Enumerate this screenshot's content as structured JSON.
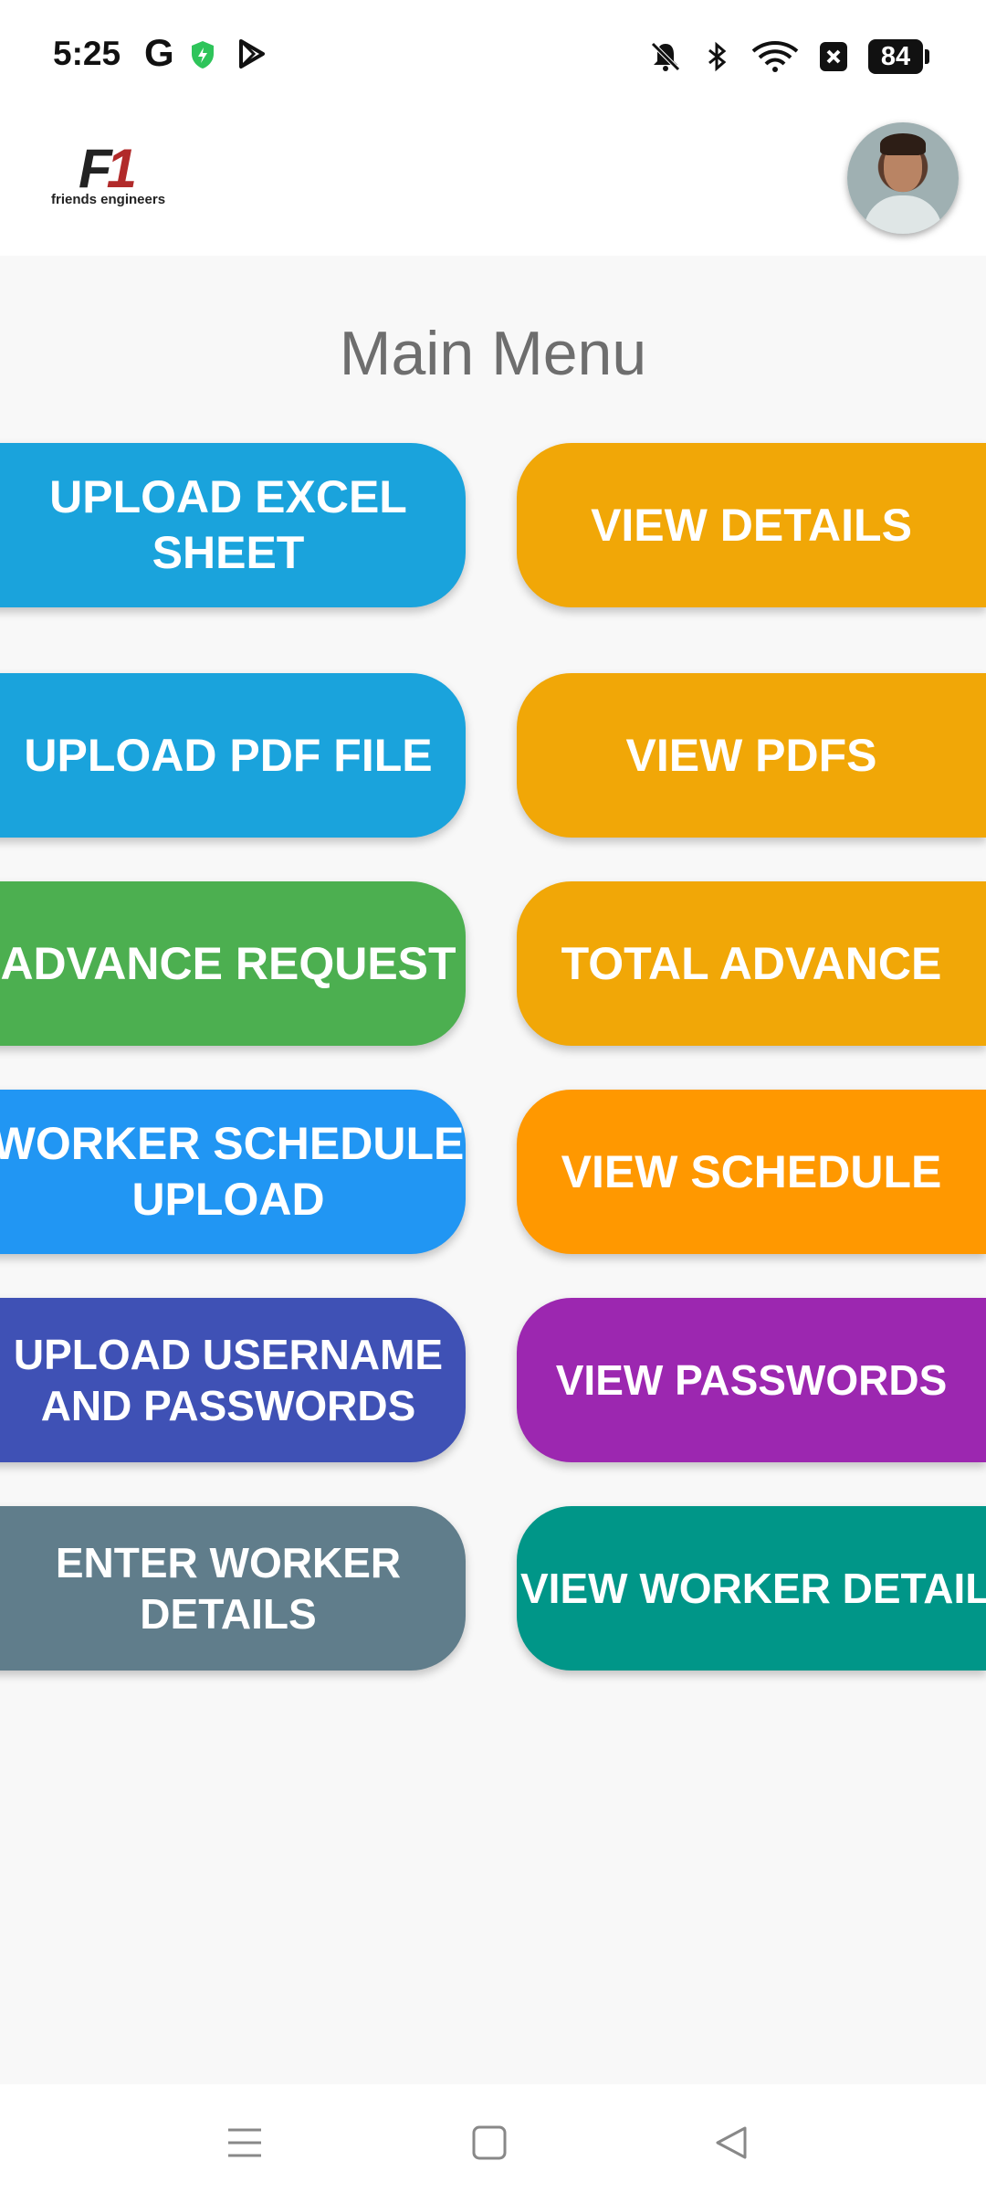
{
  "status_bar": {
    "time": "5:25",
    "g_label": "G",
    "battery": "84",
    "icons": [
      "google-icon",
      "shield-icon",
      "play-icon",
      "bell-off-icon",
      "bluetooth-icon",
      "wifi-icon",
      "close-box-icon",
      "battery-icon"
    ]
  },
  "header": {
    "logo_mark_f": "F",
    "logo_mark_one": "1",
    "logo_text": "friends engineers",
    "avatar": "user-avatar"
  },
  "main": {
    "title": "Main Menu",
    "buttons": [
      {
        "label": "UPLOAD EXCEL\nSHEET",
        "color": "#1aa3dc"
      },
      {
        "label": "VIEW DETAILS",
        "color": "#f1a707"
      },
      {
        "label": "UPLOAD PDF FILE",
        "color": "#1aa3dc"
      },
      {
        "label": "VIEW PDFS",
        "color": "#f1a707"
      },
      {
        "label": "ADVANCE REQUEST",
        "color": "#4caf50"
      },
      {
        "label": "TOTAL ADVANCE",
        "color": "#f1a707"
      },
      {
        "label": "WORKER SCHEDULE\nUPLOAD",
        "color": "#2196f3"
      },
      {
        "label": "VIEW SCHEDULE",
        "color": "#ff9800"
      },
      {
        "label": "UPLOAD USERNAME\nAND PASSWORDS",
        "color": "#3f51b5"
      },
      {
        "label": "VIEW PASSWORDS",
        "color": "#9c27b0"
      },
      {
        "label": "ENTER WORKER\nDETAILS",
        "color": "#607d8b"
      },
      {
        "label": "VIEW WORKER DETAILS",
        "color": "#009688"
      }
    ]
  },
  "nav": {
    "icons": [
      "menu-icon",
      "home-square-icon",
      "back-triangle-icon"
    ]
  }
}
